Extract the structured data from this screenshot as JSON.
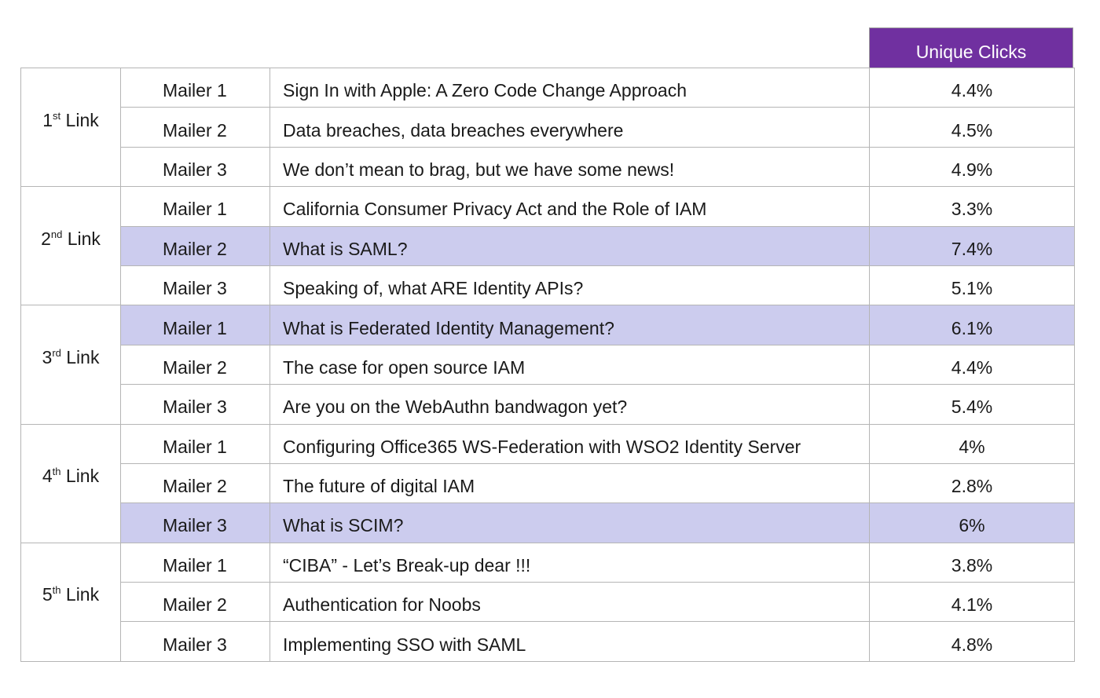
{
  "header": {
    "unique_clicks_label": "Unique Clicks"
  },
  "colors": {
    "header_bg": "#7030a0",
    "highlight_bg": "#ccccee",
    "border": "#b5b5b5"
  },
  "groups": [
    {
      "ordinal": "1",
      "suffix": "st",
      "link_word": "Link",
      "rows": [
        {
          "mailer": "Mailer 1",
          "title": "Sign In with Apple: A Zero Code Change Approach",
          "clicks": "4.4%",
          "highlight": false
        },
        {
          "mailer": "Mailer 2",
          "title": "Data breaches, data breaches everywhere",
          "clicks": "4.5%",
          "highlight": false
        },
        {
          "mailer": "Mailer 3",
          "title": "We don’t mean to brag, but we have some news!",
          "clicks": "4.9%",
          "highlight": false
        }
      ]
    },
    {
      "ordinal": "2",
      "suffix": "nd",
      "link_word": "Link",
      "rows": [
        {
          "mailer": "Mailer 1",
          "title": "California Consumer Privacy Act and the Role of IAM",
          "clicks": "3.3%",
          "highlight": false
        },
        {
          "mailer": "Mailer 2",
          "title": "What is SAML?",
          "clicks": "7.4%",
          "highlight": true
        },
        {
          "mailer": "Mailer 3",
          "title": "Speaking of, what ARE Identity APIs?",
          "clicks": "5.1%",
          "highlight": false
        }
      ]
    },
    {
      "ordinal": "3",
      "suffix": "rd",
      "link_word": "Link",
      "rows": [
        {
          "mailer": "Mailer 1",
          "title": "What is Federated Identity Management?",
          "clicks": "6.1%",
          "highlight": true
        },
        {
          "mailer": "Mailer 2",
          "title": "The case for open source IAM",
          "clicks": "4.4%",
          "highlight": false
        },
        {
          "mailer": "Mailer 3",
          "title": "Are you on the WebAuthn bandwagon yet?",
          "clicks": "5.4%",
          "highlight": false
        }
      ]
    },
    {
      "ordinal": "4",
      "suffix": "th",
      "link_word": "Link",
      "rows": [
        {
          "mailer": "Mailer 1",
          "title": "Configuring Office365 WS-Federation with WSO2 Identity Server",
          "clicks": "4%",
          "highlight": false
        },
        {
          "mailer": "Mailer 2",
          "title": "The future of digital IAM",
          "clicks": "2.8%",
          "highlight": false
        },
        {
          "mailer": "Mailer 3",
          "title": "What is SCIM?",
          "clicks": "6%",
          "highlight": true
        }
      ]
    },
    {
      "ordinal": "5",
      "suffix": "th",
      "link_word": "Link",
      "rows": [
        {
          "mailer": "Mailer 1",
          "title": "“CIBA” - Let’s Break-up dear !!!",
          "clicks": "3.8%",
          "highlight": false
        },
        {
          "mailer": "Mailer 2",
          "title": "Authentication for Noobs",
          "clicks": "4.1%",
          "highlight": false
        },
        {
          "mailer": "Mailer 3",
          "title": "Implementing SSO with SAML",
          "clicks": "4.8%",
          "highlight": false
        }
      ]
    }
  ]
}
